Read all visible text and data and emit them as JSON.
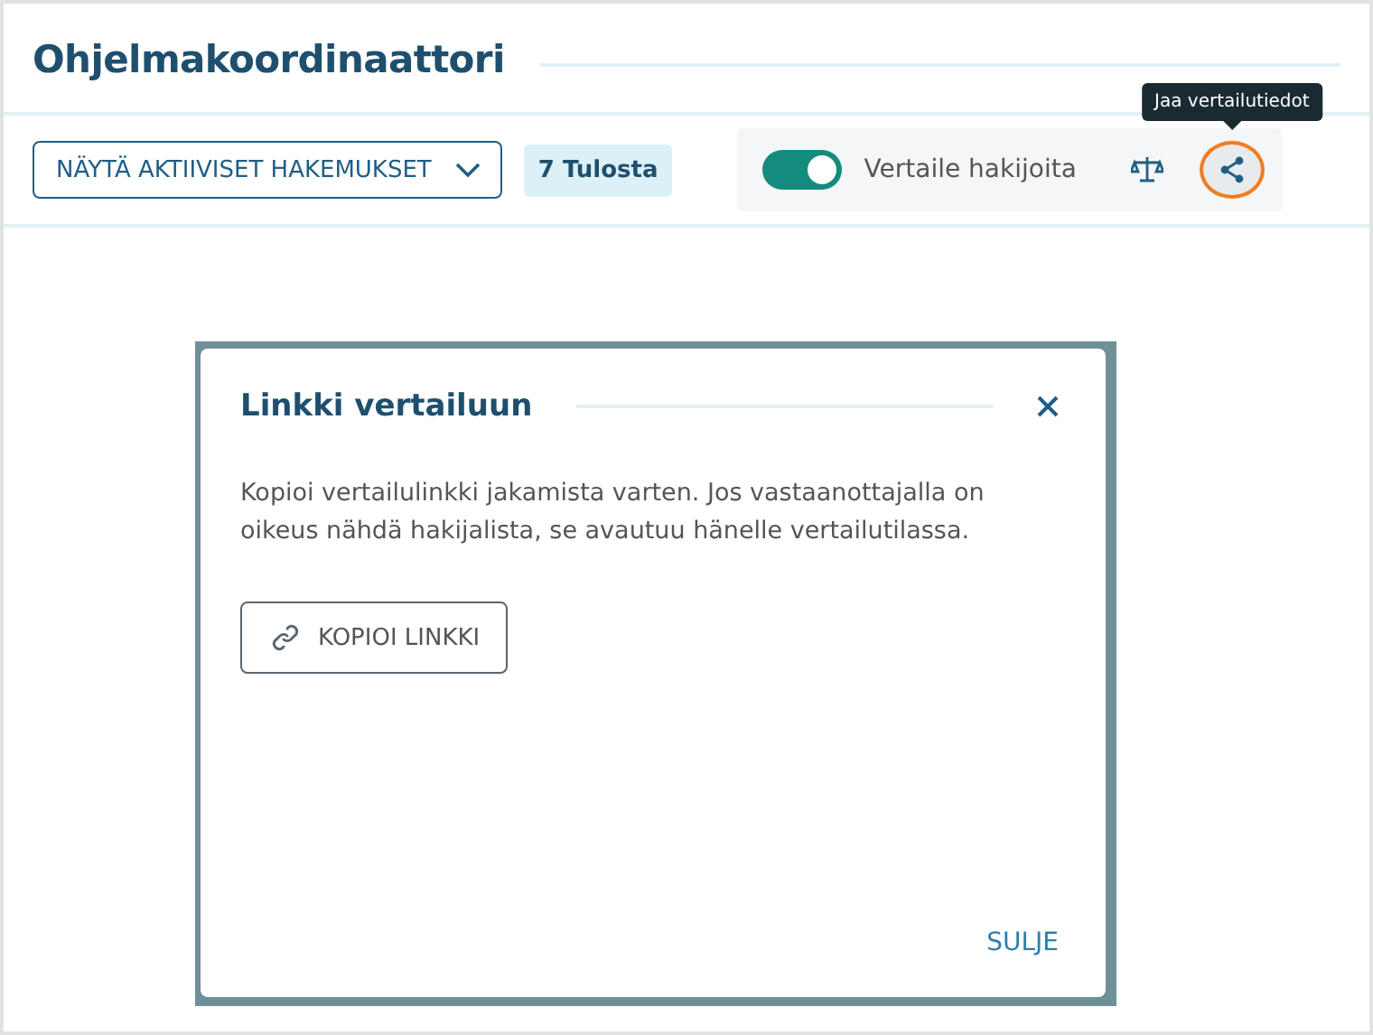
{
  "page": {
    "title": "Ohjelmakoordinaattori"
  },
  "toolbar": {
    "filter_button": "NÄYTÄ AKTIIVISET HAKEMUKSET",
    "result_count": "7 Tulosta",
    "compare_toggle": {
      "label": "Vertaile hakijoita",
      "on": true
    },
    "share_button": {
      "highlighted": true,
      "tooltip": "Jaa vertailutiedot"
    }
  },
  "dialog": {
    "title": "Linkki vertailuun",
    "message": "Kopioi vertailulinkki jakamista varten. Jos vastaanottajalla on oikeus nähdä hakijalista, se avautuu hänelle vertailutilassa.",
    "copy_button": "KOPIOI LINKKI",
    "close_button": "SULJE"
  }
}
